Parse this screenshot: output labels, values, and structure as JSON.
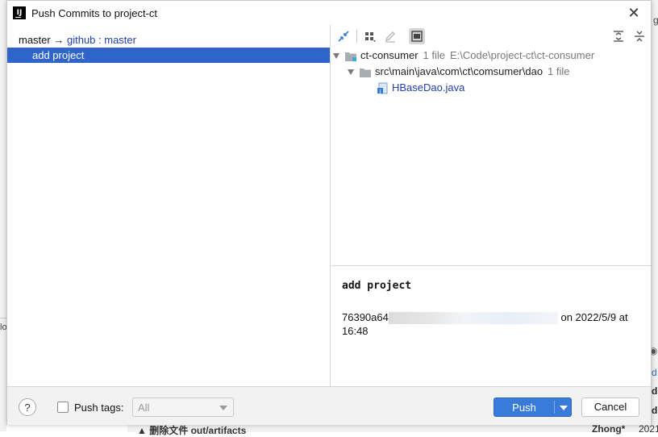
{
  "dialog": {
    "title": "Push Commits to project-ct",
    "app_icon_text": "IJ"
  },
  "left": {
    "branch_local": "master",
    "arrow": "→",
    "remote": "github",
    "separator": " : ",
    "remote_branch": "master",
    "commit_message": "add project"
  },
  "toolbar": {
    "icons": [
      "merge-arrows-icon",
      "group-by-icon",
      "edit-source-icon",
      "show-details-icon",
      "expand-all-icon",
      "collapse-all-icon"
    ]
  },
  "tree": {
    "module_name": "ct-consumer",
    "module_count": "1 file",
    "module_path": "E:\\Code\\project-ct\\ct-consumer",
    "dir_name": "src\\main\\java\\com\\ct\\comsumer\\dao",
    "dir_count": "1 file",
    "file_name": "HBaseDao.java"
  },
  "details": {
    "commit_message": "add project",
    "hash_prefix": "76390a64",
    "date_text": "on 2022/5/9 at",
    "time_text": "16:48"
  },
  "footer": {
    "help_label": "?",
    "push_tags_label": "Push tags:",
    "tags_select_value": "All",
    "push_label": "Push",
    "cancel_label": "Cancel"
  },
  "background": {
    "right_top": "ge",
    "left_fragment": "lo",
    "right_d1": "d",
    "right_d2": "d",
    "right_d3": "d",
    "bottom_left": "删除文件 out/artifacts",
    "bottom_right": "Zhong*",
    "bottom_far": "2021"
  },
  "colors": {
    "selection": "#2f65ca",
    "accent": "#3a7ad9",
    "link": "#2140a8"
  }
}
